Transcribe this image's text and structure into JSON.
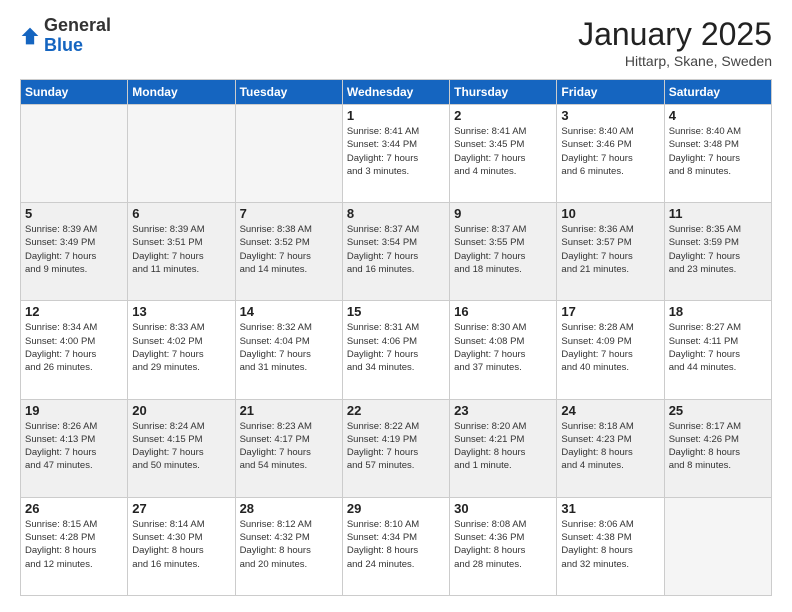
{
  "header": {
    "logo_line1": "General",
    "logo_line2": "Blue",
    "title": "January 2025",
    "subtitle": "Hittarp, Skane, Sweden"
  },
  "weekdays": [
    "Sunday",
    "Monday",
    "Tuesday",
    "Wednesday",
    "Thursday",
    "Friday",
    "Saturday"
  ],
  "weeks": [
    [
      {
        "day": "",
        "info": ""
      },
      {
        "day": "",
        "info": ""
      },
      {
        "day": "",
        "info": ""
      },
      {
        "day": "1",
        "info": "Sunrise: 8:41 AM\nSunset: 3:44 PM\nDaylight: 7 hours\nand 3 minutes."
      },
      {
        "day": "2",
        "info": "Sunrise: 8:41 AM\nSunset: 3:45 PM\nDaylight: 7 hours\nand 4 minutes."
      },
      {
        "day": "3",
        "info": "Sunrise: 8:40 AM\nSunset: 3:46 PM\nDaylight: 7 hours\nand 6 minutes."
      },
      {
        "day": "4",
        "info": "Sunrise: 8:40 AM\nSunset: 3:48 PM\nDaylight: 7 hours\nand 8 minutes."
      }
    ],
    [
      {
        "day": "5",
        "info": "Sunrise: 8:39 AM\nSunset: 3:49 PM\nDaylight: 7 hours\nand 9 minutes."
      },
      {
        "day": "6",
        "info": "Sunrise: 8:39 AM\nSunset: 3:51 PM\nDaylight: 7 hours\nand 11 minutes."
      },
      {
        "day": "7",
        "info": "Sunrise: 8:38 AM\nSunset: 3:52 PM\nDaylight: 7 hours\nand 14 minutes."
      },
      {
        "day": "8",
        "info": "Sunrise: 8:37 AM\nSunset: 3:54 PM\nDaylight: 7 hours\nand 16 minutes."
      },
      {
        "day": "9",
        "info": "Sunrise: 8:37 AM\nSunset: 3:55 PM\nDaylight: 7 hours\nand 18 minutes."
      },
      {
        "day": "10",
        "info": "Sunrise: 8:36 AM\nSunset: 3:57 PM\nDaylight: 7 hours\nand 21 minutes."
      },
      {
        "day": "11",
        "info": "Sunrise: 8:35 AM\nSunset: 3:59 PM\nDaylight: 7 hours\nand 23 minutes."
      }
    ],
    [
      {
        "day": "12",
        "info": "Sunrise: 8:34 AM\nSunset: 4:00 PM\nDaylight: 7 hours\nand 26 minutes."
      },
      {
        "day": "13",
        "info": "Sunrise: 8:33 AM\nSunset: 4:02 PM\nDaylight: 7 hours\nand 29 minutes."
      },
      {
        "day": "14",
        "info": "Sunrise: 8:32 AM\nSunset: 4:04 PM\nDaylight: 7 hours\nand 31 minutes."
      },
      {
        "day": "15",
        "info": "Sunrise: 8:31 AM\nSunset: 4:06 PM\nDaylight: 7 hours\nand 34 minutes."
      },
      {
        "day": "16",
        "info": "Sunrise: 8:30 AM\nSunset: 4:08 PM\nDaylight: 7 hours\nand 37 minutes."
      },
      {
        "day": "17",
        "info": "Sunrise: 8:28 AM\nSunset: 4:09 PM\nDaylight: 7 hours\nand 40 minutes."
      },
      {
        "day": "18",
        "info": "Sunrise: 8:27 AM\nSunset: 4:11 PM\nDaylight: 7 hours\nand 44 minutes."
      }
    ],
    [
      {
        "day": "19",
        "info": "Sunrise: 8:26 AM\nSunset: 4:13 PM\nDaylight: 7 hours\nand 47 minutes."
      },
      {
        "day": "20",
        "info": "Sunrise: 8:24 AM\nSunset: 4:15 PM\nDaylight: 7 hours\nand 50 minutes."
      },
      {
        "day": "21",
        "info": "Sunrise: 8:23 AM\nSunset: 4:17 PM\nDaylight: 7 hours\nand 54 minutes."
      },
      {
        "day": "22",
        "info": "Sunrise: 8:22 AM\nSunset: 4:19 PM\nDaylight: 7 hours\nand 57 minutes."
      },
      {
        "day": "23",
        "info": "Sunrise: 8:20 AM\nSunset: 4:21 PM\nDaylight: 8 hours\nand 1 minute."
      },
      {
        "day": "24",
        "info": "Sunrise: 8:18 AM\nSunset: 4:23 PM\nDaylight: 8 hours\nand 4 minutes."
      },
      {
        "day": "25",
        "info": "Sunrise: 8:17 AM\nSunset: 4:26 PM\nDaylight: 8 hours\nand 8 minutes."
      }
    ],
    [
      {
        "day": "26",
        "info": "Sunrise: 8:15 AM\nSunset: 4:28 PM\nDaylight: 8 hours\nand 12 minutes."
      },
      {
        "day": "27",
        "info": "Sunrise: 8:14 AM\nSunset: 4:30 PM\nDaylight: 8 hours\nand 16 minutes."
      },
      {
        "day": "28",
        "info": "Sunrise: 8:12 AM\nSunset: 4:32 PM\nDaylight: 8 hours\nand 20 minutes."
      },
      {
        "day": "29",
        "info": "Sunrise: 8:10 AM\nSunset: 4:34 PM\nDaylight: 8 hours\nand 24 minutes."
      },
      {
        "day": "30",
        "info": "Sunrise: 8:08 AM\nSunset: 4:36 PM\nDaylight: 8 hours\nand 28 minutes."
      },
      {
        "day": "31",
        "info": "Sunrise: 8:06 AM\nSunset: 4:38 PM\nDaylight: 8 hours\nand 32 minutes."
      },
      {
        "day": "",
        "info": ""
      }
    ]
  ]
}
